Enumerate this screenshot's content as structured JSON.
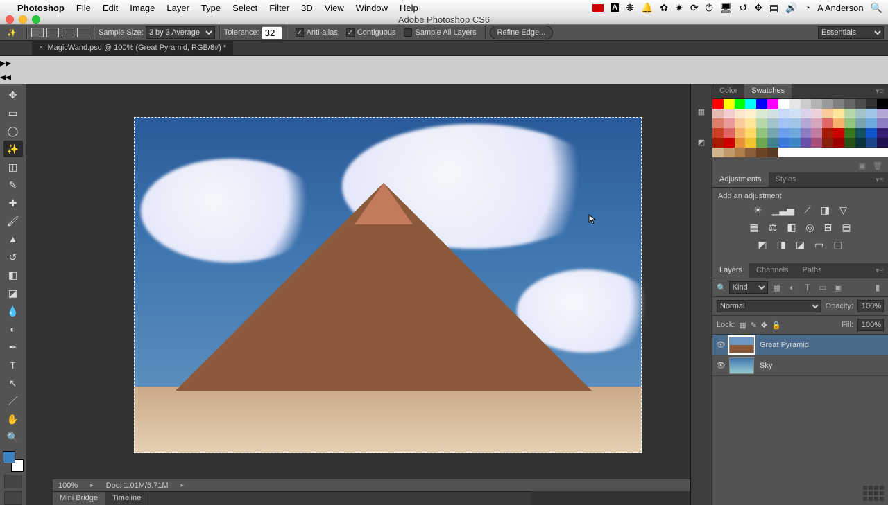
{
  "menubar": {
    "appname": "Photoshop",
    "items": [
      "File",
      "Edit",
      "Image",
      "Layer",
      "Type",
      "Select",
      "Filter",
      "3D",
      "View",
      "Window",
      "Help"
    ],
    "user": "A Anderson"
  },
  "window_title": "Adobe Photoshop CS6",
  "options": {
    "sample_size_label": "Sample Size:",
    "sample_size_value": "3 by 3 Average",
    "tolerance_label": "Tolerance:",
    "tolerance_value": "32",
    "antialias": "Anti-alias",
    "contiguous": "Contiguous",
    "sample_all": "Sample All Layers",
    "refine": "Refine Edge...",
    "workspace": "Essentials"
  },
  "tab": {
    "close": "×",
    "label": "MagicWand.psd @ 100% (Great Pyramid, RGB/8#) *"
  },
  "status": {
    "zoom": "100%",
    "doc": "Doc: 1.01M/6.71M"
  },
  "bottom_tabs": {
    "a": "Mini Bridge",
    "b": "Timeline"
  },
  "panels": {
    "color_tab": "Color",
    "swatches_tab": "Swatches",
    "adjustments_tab": "Adjustments",
    "styles_tab": "Styles",
    "add_adjustment": "Add an adjustment",
    "layers_tab": "Layers",
    "channels_tab": "Channels",
    "paths_tab": "Paths",
    "filter_kind": "Kind",
    "blend_mode": "Normal",
    "opacity_label": "Opacity:",
    "opacity_value": "100%",
    "lock_label": "Lock:",
    "fill_label": "Fill:",
    "fill_value": "100%",
    "layer1": "Great Pyramid",
    "layer2": "Sky"
  },
  "swatch_colors": [
    "#ff0000",
    "#ffff00",
    "#00ff00",
    "#00ffff",
    "#0000ff",
    "#ff00ff",
    "#ffffff",
    "#e6e6e6",
    "#cccccc",
    "#b3b3b3",
    "#999999",
    "#808080",
    "#666666",
    "#4d4d4d",
    "#333333",
    "#000000",
    "#e6b8af",
    "#f4cccc",
    "#fce5cd",
    "#fff2cc",
    "#d9ead3",
    "#d0e0e3",
    "#c9daf8",
    "#cfe2f3",
    "#d9d2e9",
    "#ead1dc",
    "#f9cb9c",
    "#ffe599",
    "#b6d7a8",
    "#a2c4c9",
    "#9fc5e8",
    "#b4a7d6",
    "#dd7e6b",
    "#ea9999",
    "#f9cb9c",
    "#ffe599",
    "#b6d7a8",
    "#a2c4c9",
    "#a4c2f4",
    "#9fc5e8",
    "#b4a7d6",
    "#d5a6bd",
    "#e06666",
    "#f6b26b",
    "#93c47d",
    "#76a5af",
    "#6fa8dc",
    "#8e7cc3",
    "#cc4125",
    "#e06666",
    "#f6b26b",
    "#ffd966",
    "#93c47d",
    "#76a5af",
    "#6d9eeb",
    "#6fa8dc",
    "#8e7cc3",
    "#c27ba0",
    "#a61c00",
    "#cc0000",
    "#38761d",
    "#134f5c",
    "#1155cc",
    "#351c75",
    "#a61c00",
    "#cc0000",
    "#e69138",
    "#f1c232",
    "#6aa84f",
    "#45818e",
    "#3c78d8",
    "#3d85c6",
    "#674ea7",
    "#a64d79",
    "#85200c",
    "#990000",
    "#274e13",
    "#0c343d",
    "#1c4587",
    "#20124d",
    "#d2b48c",
    "#c19a6b",
    "#af7f4e",
    "#8b5e3c",
    "#6b4423",
    "#5a3a22",
    "#ffffff",
    "#ffffff",
    "#ffffff",
    "#ffffff",
    "#ffffff",
    "#ffffff",
    "#ffffff",
    "#ffffff",
    "#ffffff",
    "#ffffff"
  ]
}
